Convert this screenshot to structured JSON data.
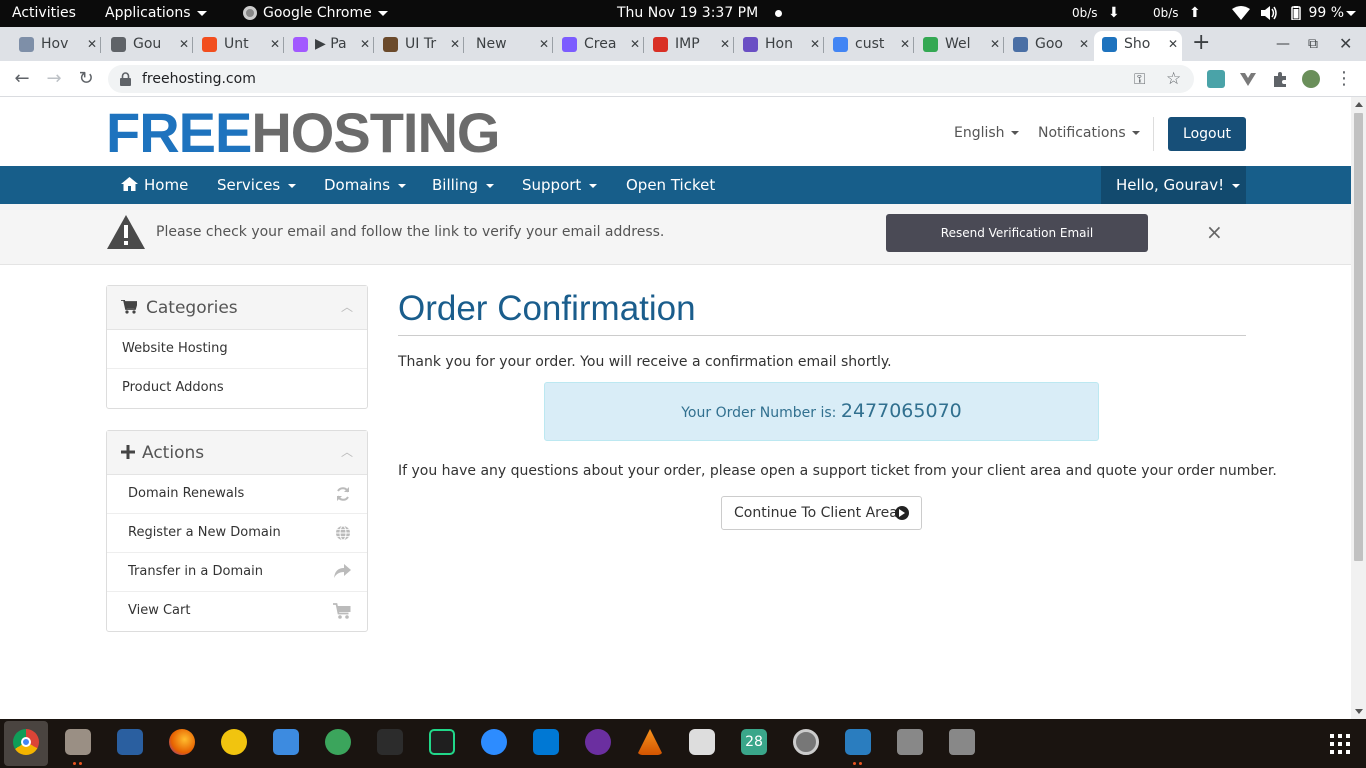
{
  "system": {
    "activities": "Activities",
    "applications": "Applications",
    "app_name": "Google Chrome",
    "datetime": "Thu Nov 19  3:37 PM",
    "net_down": "0b/s",
    "net_up": "0b/s",
    "battery": "99 %"
  },
  "tabs": [
    {
      "title": "Hov",
      "favicon_color": "#7e8fa8"
    },
    {
      "title": "Gou",
      "favicon_color": "#5f6368"
    },
    {
      "title": "Unt",
      "favicon_color": "#f24e1e"
    },
    {
      "title": "▶ Pa",
      "favicon_color": "#a259ff"
    },
    {
      "title": "UI Tr",
      "favicon_color": "#6b4a2b"
    },
    {
      "title": "New Ta",
      "favicon_color": ""
    },
    {
      "title": "Crea",
      "favicon_color": "#7c5cff"
    },
    {
      "title": "IMP",
      "favicon_color": "#d93025"
    },
    {
      "title": "Hon",
      "favicon_color": "#6a4fc4"
    },
    {
      "title": "cust",
      "favicon_color": "#4285f4"
    },
    {
      "title": "Wel",
      "favicon_color": "#34a853"
    },
    {
      "title": "Goo",
      "favicon_color": "#4a6fa5"
    },
    {
      "title": "Sho",
      "favicon_color": "#1e73be"
    }
  ],
  "address": {
    "url": "freehosting.com"
  },
  "site": {
    "logo_part1": "FREE",
    "logo_part2": "HOSTING",
    "language": "English",
    "notifications": "Notifications",
    "logout": "Logout",
    "nav": {
      "home": "Home",
      "services": "Services",
      "domains": "Domains",
      "billing": "Billing",
      "support": "Support",
      "open_ticket": "Open Ticket",
      "user": "Hello, Gourav!"
    },
    "verify": {
      "message": "Please check your email and follow the link to verify your email address.",
      "resend": "Resend Verification Email",
      "close": "×"
    },
    "categories": {
      "title": "Categories",
      "items": [
        "Website Hosting",
        "Product Addons"
      ]
    },
    "actions": {
      "title": "Actions",
      "items": [
        {
          "label": "Domain Renewals",
          "icon": "refresh-icon"
        },
        {
          "label": "Register a New Domain",
          "icon": "globe-icon"
        },
        {
          "label": "Transfer in a Domain",
          "icon": "share-arrow-icon"
        },
        {
          "label": "View Cart",
          "icon": "cart-icon"
        }
      ]
    },
    "order": {
      "heading": "Order Confirmation",
      "thanks": "Thank you for your order. You will receive a confirmation email shortly.",
      "number_label": "Your Order Number is: ",
      "number": "2477065070",
      "questions": "If you have any questions about your order, please open a support ticket from your client area and quote your order number.",
      "continue": "Continue To Client Area"
    }
  },
  "dock": {
    "calendar_day": "28"
  },
  "colors": {
    "brand_blue": "#1e73be",
    "nav_bg": "#175e8a",
    "heading_blue": "#1a5d8c",
    "info_bg": "#d9edf7"
  }
}
